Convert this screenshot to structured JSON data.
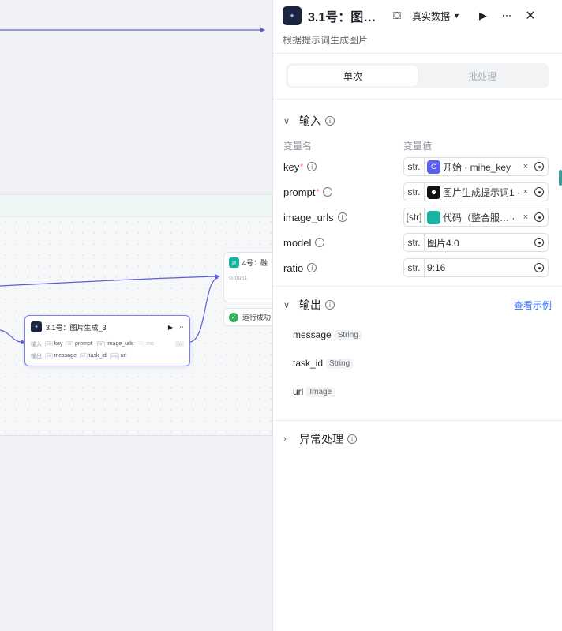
{
  "canvas": {
    "node_31": {
      "title": "3.1号：图片生成_3",
      "inputs_label": "输入",
      "outputs_label": "输出",
      "inputs": [
        {
          "type": "str",
          "name": "key"
        },
        {
          "type": "str",
          "name": "prompt"
        },
        {
          "type": "[str]",
          "name": "image_urls"
        },
        {
          "type": "str",
          "name": "mo"
        }
      ],
      "outputs": [
        {
          "type": "str",
          "name": "message"
        },
        {
          "type": "str",
          "name": "task_id"
        },
        {
          "type": "img",
          "name": "url"
        }
      ]
    },
    "node_4": {
      "title": "4号：融",
      "group_label": "Group1"
    },
    "run_status": "运行成功"
  },
  "panel": {
    "title": "3.1号：图…",
    "data_mode": "真实数据",
    "description": "根据提示词生成图片",
    "tabs": [
      {
        "label": "单次",
        "active": true
      },
      {
        "label": "批处理",
        "active": false
      }
    ],
    "input_section": {
      "title": "输入",
      "col_name": "变量名",
      "col_value": "变量值",
      "rows": [
        {
          "name": "key",
          "required": true,
          "type": "str.",
          "value": "开始 · mihe_key",
          "badge_color": "#5b5ff0",
          "badge_icon": "start-icon",
          "badge_glyph": "G",
          "clearable": true
        },
        {
          "name": "prompt",
          "required": true,
          "type": "str.",
          "value": "图片生成提示词1 · (",
          "badge_color": "#111111",
          "badge_icon": "llm-icon",
          "badge_glyph": "☻",
          "clearable": true
        },
        {
          "name": "image_urls",
          "required": false,
          "type": "[str]",
          "value": "代码（整合服…  ·",
          "badge_color": "#17b3a3",
          "badge_icon": "code-icon",
          "badge_glyph": "</>",
          "clearable": true
        },
        {
          "name": "model",
          "required": false,
          "type": "str.",
          "value": "图片4.0",
          "badge_color": "",
          "badge_icon": "",
          "badge_glyph": "",
          "clearable": false
        },
        {
          "name": "ratio",
          "required": false,
          "type": "str.",
          "value": "9:16",
          "badge_color": "",
          "badge_icon": "",
          "badge_glyph": "",
          "clearable": false
        }
      ]
    },
    "output_section": {
      "title": "输出",
      "example_link": "查看示例",
      "rows": [
        {
          "name": "message",
          "type": "String"
        },
        {
          "name": "task_id",
          "type": "String"
        },
        {
          "name": "url",
          "type": "Image"
        }
      ]
    },
    "exception_section": {
      "title": "异常处理"
    }
  },
  "colors": {
    "accent": "#3370ff",
    "edge": "#5b5fd6",
    "success": "#31b057",
    "required": "#f54a45"
  }
}
